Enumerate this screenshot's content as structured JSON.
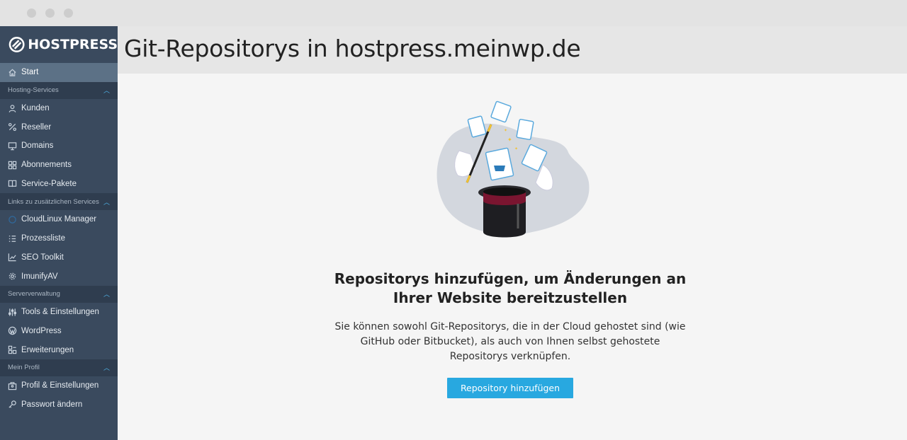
{
  "brand": {
    "name": "HOSTPRESS"
  },
  "header": {
    "title": "Git-Repositorys in hostpress.meinwp.de"
  },
  "sidebar": {
    "start": {
      "label": "Start",
      "icon": "home-icon"
    },
    "groups": [
      {
        "title": "Hosting-Services",
        "items": [
          {
            "label": "Kunden",
            "icon": "user-icon"
          },
          {
            "label": "Reseller",
            "icon": "percent-icon"
          },
          {
            "label": "Domains",
            "icon": "monitor-icon"
          },
          {
            "label": "Abonnements",
            "icon": "grid-icon"
          },
          {
            "label": "Service-Pakete",
            "icon": "book-icon"
          }
        ]
      },
      {
        "title": "Links zu zusätzlichen Services",
        "items": [
          {
            "label": "CloudLinux Manager",
            "icon": "cloudlinux-icon"
          },
          {
            "label": "Prozessliste",
            "icon": "list-icon"
          },
          {
            "label": "SEO Toolkit",
            "icon": "chart-icon"
          },
          {
            "label": "ImunifyAV",
            "icon": "gear-icon"
          }
        ]
      },
      {
        "title": "Serververwaltung",
        "items": [
          {
            "label": "Tools & Einstellungen",
            "icon": "sliders-icon"
          },
          {
            "label": "WordPress",
            "icon": "wordpress-icon"
          },
          {
            "label": "Erweiterungen",
            "icon": "puzzle-icon"
          }
        ]
      },
      {
        "title": "Mein Profil",
        "items": [
          {
            "label": "Profil & Einstellungen",
            "icon": "profile-icon"
          },
          {
            "label": "Passwort ändern",
            "icon": "key-icon"
          }
        ]
      }
    ]
  },
  "main": {
    "headline": "Repositorys hinzufügen, um Änderungen an Ihrer Website bereitzustellen",
    "description": "Sie können sowohl Git-Repositorys, die in der Cloud gehostet sind (wie GitHub oder Bitbucket), als auch von Ihnen selbst gehostete Repositorys verknüpfen.",
    "button_label": "Repository hinzufügen"
  },
  "colors": {
    "sidebar": "#3a4a5e",
    "sidebar_active": "#5c7186",
    "group_header": "#2f3d4f",
    "accent": "#28a8e0"
  }
}
